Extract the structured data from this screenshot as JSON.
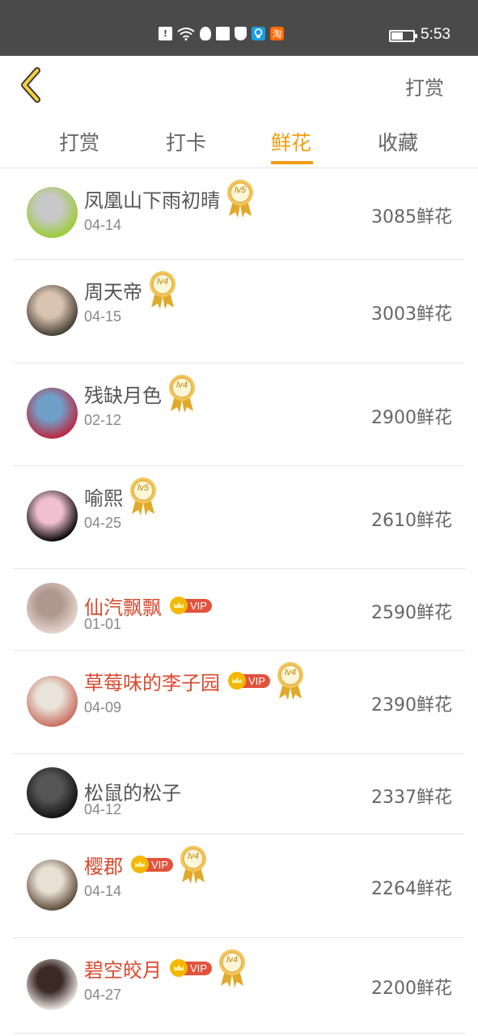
{
  "status_bar": {
    "time": "5:53",
    "battery_level": 0.5,
    "icons": [
      "alert-icon",
      "wifi-icon",
      "qq-icon",
      "gallery-icon",
      "shield-icon",
      "bulb-icon",
      "taobao-icon"
    ],
    "taobao_label": "淘"
  },
  "header": {
    "action_label": "打赏"
  },
  "tabs": [
    {
      "label": "打赏",
      "active": false
    },
    {
      "label": "打卡",
      "active": false
    },
    {
      "label": "鲜花",
      "active": true
    },
    {
      "label": "收藏",
      "active": false
    }
  ],
  "colors": {
    "accent": "#f39c12",
    "vip_name": "#d94a2f",
    "status_bar": "#4a4a4a"
  },
  "rows": [
    {
      "name": "凤凰山下雨初晴",
      "date": "04-14",
      "amount": "3085鲜花",
      "vip": false,
      "vip_label": "",
      "level": "lv5",
      "avatar_colors": [
        "#9acd32",
        "#c8c8c8"
      ]
    },
    {
      "name": "周天帝",
      "date": "04-15",
      "amount": "3003鲜花",
      "vip": false,
      "vip_label": "",
      "level": "lv4",
      "avatar_colors": [
        "#3e3a2e",
        "#d8c2b0"
      ]
    },
    {
      "name": "残缺月色",
      "date": "02-12",
      "amount": "2900鲜花",
      "vip": false,
      "vip_label": "",
      "level": "lv4",
      "avatar_colors": [
        "#c0243b",
        "#6f9fc8"
      ]
    },
    {
      "name": "喻熙",
      "date": "04-25",
      "amount": "2610鲜花",
      "vip": false,
      "vip_label": "",
      "level": "lv5",
      "avatar_colors": [
        "#000000",
        "#f0c0d0"
      ]
    },
    {
      "name": "仙汽飘飘",
      "date": "01-01",
      "amount": "2590鲜花",
      "vip": true,
      "vip_label": "VIP",
      "level": "",
      "avatar_colors": [
        "#e8d8d0",
        "#b09890"
      ]
    },
    {
      "name": "草莓味的李子园",
      "date": "04-09",
      "amount": "2390鲜花",
      "vip": true,
      "vip_label": "VIP",
      "level": "lv4",
      "avatar_colors": [
        "#c76a5a",
        "#e9e3d9"
      ]
    },
    {
      "name": "松鼠的松子",
      "date": "04-12",
      "amount": "2337鲜花",
      "vip": false,
      "vip_label": "",
      "level": "",
      "avatar_colors": [
        "#111111",
        "#555555"
      ]
    },
    {
      "name": "樱郡",
      "date": "04-14",
      "amount": "2264鲜花",
      "vip": true,
      "vip_label": "VIP",
      "level": "lv4",
      "avatar_colors": [
        "#5a4636",
        "#e8e0d4"
      ]
    },
    {
      "name": "碧空皎月",
      "date": "04-27",
      "amount": "2200鲜花",
      "vip": true,
      "vip_label": "VIP",
      "level": "lv4",
      "avatar_colors": [
        "#f2ece8",
        "#3a2a26"
      ]
    }
  ]
}
